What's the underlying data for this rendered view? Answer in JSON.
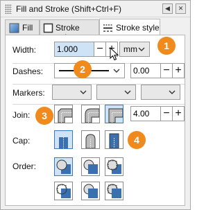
{
  "window": {
    "title": "Fill and Stroke (Shift+Ctrl+F)",
    "buttons": [
      "◀",
      "✕"
    ]
  },
  "tabs": [
    {
      "label": "Fill",
      "icon": "fill-icon",
      "active": false
    },
    {
      "label": "Stroke paint",
      "icon": "stroke-paint-icon",
      "active": false
    },
    {
      "label": "Stroke style",
      "icon": "stroke-style-icon",
      "active": true
    }
  ],
  "width": {
    "label": "Width:",
    "value": "1.000",
    "minus": "−",
    "plus": "+",
    "unit": "mm"
  },
  "dashes": {
    "label": "Dashes:",
    "offset": "0.00",
    "minus": "−",
    "plus": "+"
  },
  "markers": {
    "label": "Markers:"
  },
  "join": {
    "label": "Join:",
    "miter_limit": "4.00",
    "minus": "−",
    "plus": "+",
    "options": [
      "bevel-join-icon",
      "round-join-icon",
      "miter-join-icon"
    ],
    "selected": 2
  },
  "cap": {
    "label": "Cap:",
    "options": [
      "butt-cap-icon",
      "round-cap-icon",
      "square-cap-icon"
    ],
    "selected": 0
  },
  "order": {
    "label": "Order:",
    "options": [
      "fill-stroke-markers-icon",
      "stroke-fill-markers-icon",
      "fill-markers-stroke-icon",
      "markers-fill-stroke-icon",
      "stroke-markers-fill-icon",
      "markers-stroke-fill-icon"
    ],
    "selected": 0
  },
  "badges": [
    "1",
    "2",
    "3",
    "4"
  ],
  "colors": {
    "badge": "#f08a1c",
    "selected_tile": "#cfe3f7",
    "accent": "#3a78c2",
    "fill_shape": "#3a6fb0"
  }
}
